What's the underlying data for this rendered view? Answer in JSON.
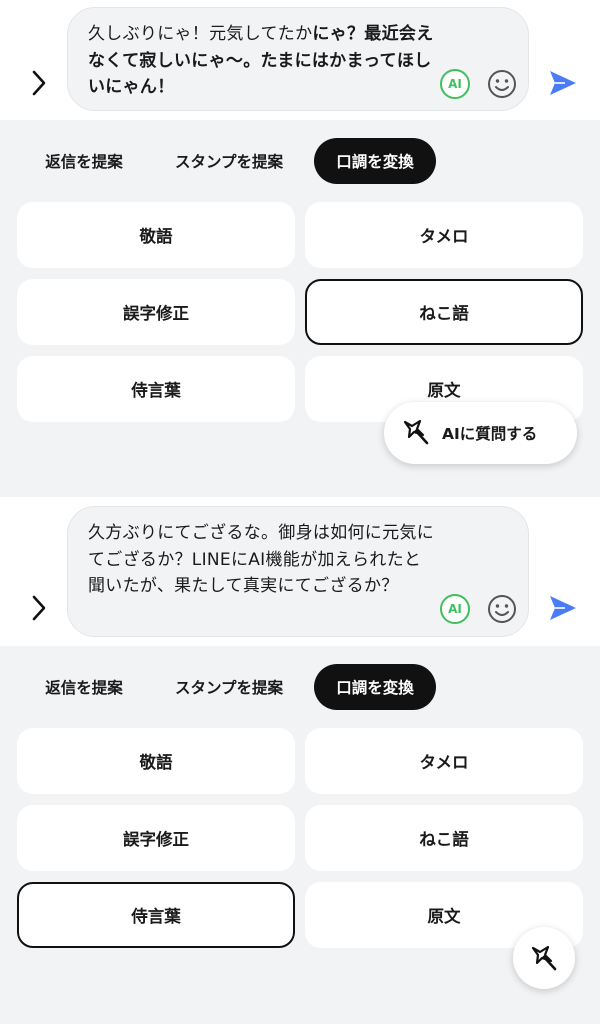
{
  "colors": {
    "accent_send": "#4a7cf7",
    "ai_badge": "#3fbf5f",
    "selected_tab_bg": "#111111",
    "panel_bg": "#f2f3f5"
  },
  "panels": [
    {
      "message": {
        "normal": "久しぶりにゃ！元気してたか",
        "bold": "にゃ？最近会えなくて寂しいにゃ〜。たまにはかまってほしいにゃん！"
      },
      "ai_badge": "AI",
      "tabs": [
        "返信を提案",
        "スタンプを提案",
        "口調を変換"
      ],
      "options": [
        "敬語",
        "タメロ",
        "誤字修正",
        "ねこ語",
        "侍言葉",
        "原文"
      ],
      "selected_option": "ねこ語",
      "ai_question_label": "AIに質問する"
    },
    {
      "message": {
        "normal": "久方ぶりにてござるな。御身は如何に元気にてござるか？LINEにAI機能が加えられたと聞いたが、果たして真実にてござるか？",
        "bold": ""
      },
      "ai_badge": "AI",
      "tabs": [
        "返信を提案",
        "スタンプを提案",
        "口調を変換"
      ],
      "options": [
        "敬語",
        "タメロ",
        "誤字修正",
        "ねこ語",
        "侍言葉",
        "原文"
      ],
      "selected_option": "侍言葉"
    }
  ],
  "icons": {
    "expand": "chevron-right-icon",
    "emoji": "smiley-icon",
    "send": "send-icon",
    "ai_wand": "magic-wand-icon"
  }
}
